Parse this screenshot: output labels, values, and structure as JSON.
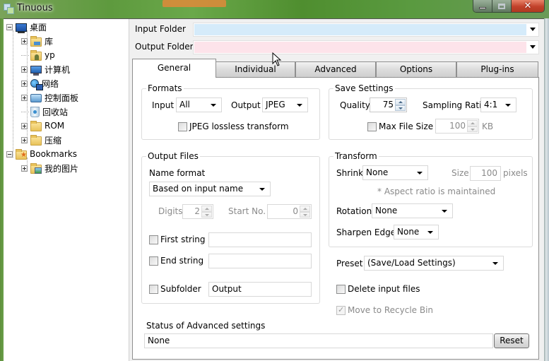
{
  "window": {
    "title": "Tinuous",
    "controls": {
      "minimize": "minimize",
      "maximize": "maximize",
      "close": "close"
    }
  },
  "tree": {
    "items": [
      {
        "label": "桌面",
        "icon": "desktop-icon",
        "expander": "minus",
        "level": 0
      },
      {
        "label": "库",
        "icon": "library-folder-icon",
        "expander": "plus",
        "level": 1
      },
      {
        "label": "yp",
        "icon": "user-folder-icon",
        "expander": "none",
        "level": 1
      },
      {
        "label": "计算机",
        "icon": "computer-icon",
        "expander": "plus",
        "level": 1
      },
      {
        "label": "网络",
        "icon": "network-icon",
        "expander": "plus",
        "level": 1
      },
      {
        "label": "控制面板",
        "icon": "control-panel-icon",
        "expander": "plus",
        "level": 1
      },
      {
        "label": "回收站",
        "icon": "recycle-bin-icon",
        "expander": "none",
        "level": 1
      },
      {
        "label": "ROM",
        "icon": "folder-icon",
        "expander": "plus",
        "level": 1
      },
      {
        "label": "压缩",
        "icon": "folder-icon",
        "expander": "plus",
        "level": 1
      },
      {
        "label": "Bookmarks",
        "icon": "bookmarks-folder-icon",
        "expander": "minus",
        "level": 0
      },
      {
        "label": "我的图片",
        "icon": "pictures-folder-icon",
        "expander": "plus",
        "level": 1
      }
    ]
  },
  "folders": {
    "input_label": "Input Folder",
    "input_value": "",
    "input_color": "#d5ebfa",
    "output_label": "Output Folder",
    "output_value": "",
    "output_color": "#fde3ea"
  },
  "tabs": [
    {
      "label": "General",
      "active": true
    },
    {
      "label": "Individual",
      "active": false
    },
    {
      "label": "Advanced",
      "active": false
    },
    {
      "label": "Options",
      "active": false
    },
    {
      "label": "Plug-ins",
      "active": false
    }
  ],
  "formats": {
    "title": "Formats",
    "input_label": "Input",
    "input_value": "All",
    "output_label": "Output",
    "output_value": "JPEG",
    "lossless_label": "JPEG lossless transform",
    "lossless_checked": false
  },
  "save_settings": {
    "title": "Save Settings",
    "quality_label": "Quality",
    "quality_value": "75",
    "sampling_label": "Sampling Ratio",
    "sampling_value": "4:1",
    "max_size_label": "Max File Size",
    "max_size_checked": false,
    "max_size_value": "100",
    "max_size_unit": "KB"
  },
  "output_files": {
    "title": "Output Files",
    "name_format_label": "Name format",
    "name_format_value": "Based on input name",
    "digits_label": "Digits",
    "digits_value": "2",
    "start_no_label": "Start No.",
    "start_no_value": "0",
    "first_string_label": "First string",
    "first_string_value": "",
    "end_string_label": "End string",
    "end_string_value": "",
    "subfolder_label": "Subfolder",
    "subfolder_value": "Output"
  },
  "transform": {
    "title": "Transform",
    "shrink_label": "Shrink",
    "shrink_value": "None",
    "size_label": "Size",
    "size_value": "100",
    "size_unit": "pixels",
    "aspect_note": "* Aspect ratio is maintained",
    "rotation_label": "Rotation",
    "rotation_value": "None",
    "sharpen_label": "Sharpen Edge",
    "sharpen_value": "None"
  },
  "preset": {
    "label": "Preset",
    "value": "(Save/Load Settings)"
  },
  "delete_input": {
    "label": "Delete input files",
    "checked": false
  },
  "recycle_bin": {
    "label": "Move to Recycle Bin",
    "checked": true,
    "disabled": true
  },
  "status": {
    "label": "Status of Advanced settings",
    "value": "None",
    "reset_label": "Reset"
  }
}
